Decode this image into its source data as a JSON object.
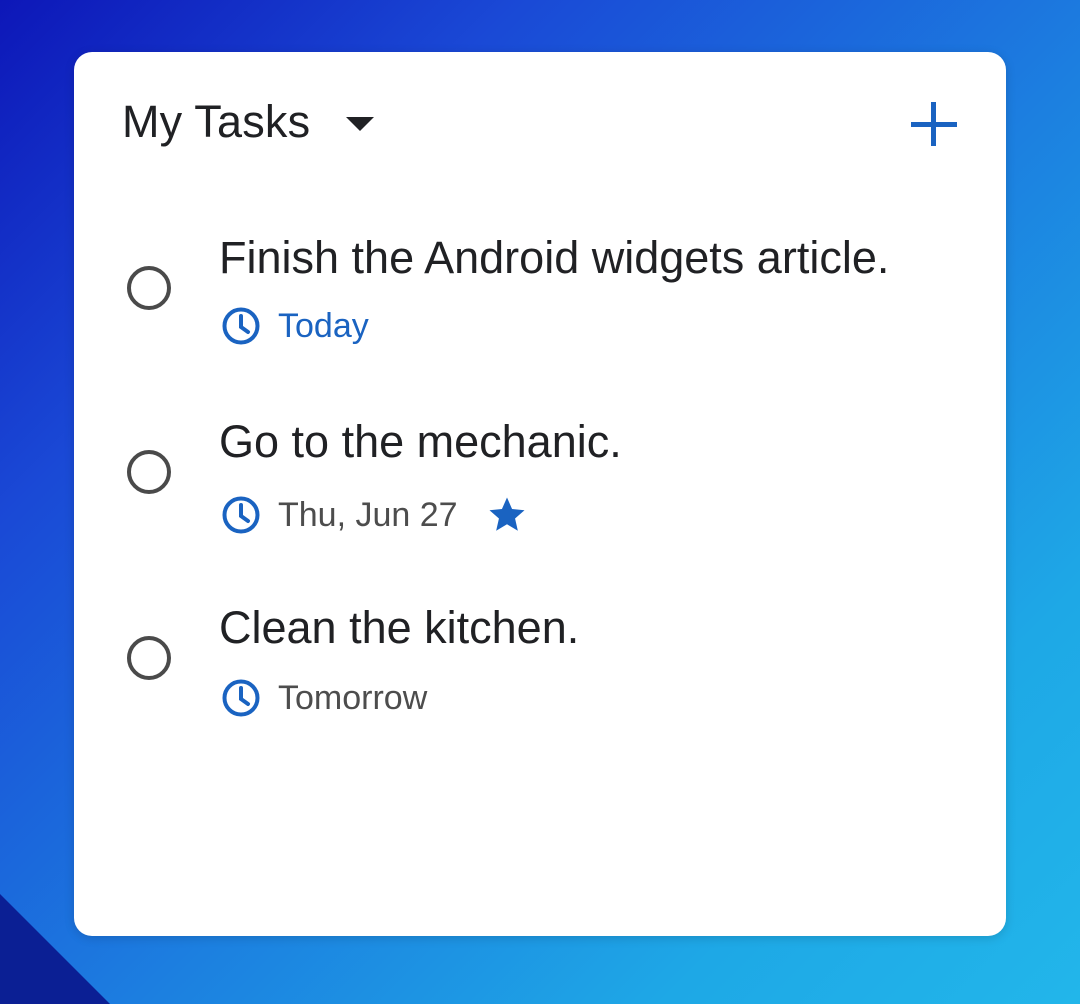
{
  "widget": {
    "title": "My Tasks"
  },
  "colors": {
    "accent": "#1a63c1",
    "text_primary": "#202124",
    "text_secondary": "#4d4d4d",
    "checkbox": "#4a4a4a"
  },
  "icons": {
    "dropdown": "triangle-down-icon",
    "add": "plus-icon",
    "checkbox": "circle-outline-icon",
    "due": "clock-icon",
    "starred": "star-icon"
  },
  "tasks": [
    {
      "title": "Finish the Android widgets article.",
      "due": "Today",
      "starred": false
    },
    {
      "title": "Go to the mechanic.",
      "due": "Thu, Jun 27",
      "starred": true
    },
    {
      "title": "Clean the kitchen.",
      "due": "Tomorrow",
      "starred": false
    }
  ]
}
